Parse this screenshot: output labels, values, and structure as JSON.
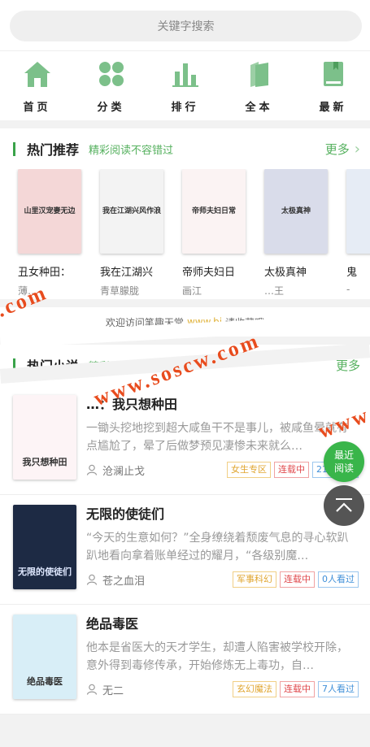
{
  "search": {
    "placeholder": "关键字搜索"
  },
  "nav": [
    {
      "label": "首页",
      "icon": "home-icon"
    },
    {
      "label": "分类",
      "icon": "category-icon"
    },
    {
      "label": "排行",
      "icon": "ranking-icon"
    },
    {
      "label": "全本",
      "icon": "complete-books-icon"
    },
    {
      "label": "最新",
      "icon": "latest-book-icon"
    }
  ],
  "hot_recommend": {
    "title": "热门推荐",
    "subtitle": "精彩阅读不容错过",
    "more": "更多",
    "books": [
      {
        "title": "丑女种田：",
        "author": "薄…",
        "cover_text": "山里汉宠妻无边",
        "cover_color": "#f4d7d7"
      },
      {
        "title": "我在江湖兴",
        "author": "青草朦胧",
        "cover_text": "我在江湖兴风作浪",
        "cover_color": "#f3f3f3"
      },
      {
        "title": "帝师夫妇日",
        "author": "画江",
        "cover_text": "帝师夫妇日常",
        "cover_color": "#fbf3f3"
      },
      {
        "title": "太极真神",
        "author": "…王",
        "cover_text": "太极真神",
        "cover_color": "#d9dcea"
      },
      {
        "title": "鬼",
        "author": "-",
        "cover_text": "",
        "cover_color": "#e6ecf5"
      }
    ]
  },
  "welcome": {
    "prefix": "欢迎访问笔趣天堂",
    "url": "www.bi",
    "suffix": "请收藏哦"
  },
  "hot_novels": {
    "title": "热门小说",
    "subtitle": "精彩…",
    "more": "更多",
    "items": [
      {
        "title": "…：我只想种田",
        "desc": "一锄头挖地挖到超大咸鱼干不是事儿，被咸鱼晕就有点尴尬了，晕了后做梦预见凄惨未来就么…",
        "author": "沧澜止戈",
        "category": "女生专区",
        "status": "连载中",
        "views": "21人看过",
        "cover_text": "我只想种田",
        "cover_color": "#fdf4f6"
      },
      {
        "title": "无限的使徒们",
        "desc": "“今天的生意如何？”全身缭绕着颓废气息的寻心软趴趴地看向拿着账单经过的耀月，“各级别魔…",
        "author": "苍之血泪",
        "category": "军事科幻",
        "status": "连载中",
        "views": "0人看过",
        "cover_text": "无限的使徒们",
        "cover_color": "#1d2a44"
      },
      {
        "title": "绝品毒医",
        "desc": "他本是省医大的天才学生，却遭人陷害被学校开除，意外得到毒修传承，开始修炼无上毒功，自…",
        "author": "无二",
        "category": "玄幻魔法",
        "status": "连载中",
        "views": "7人看过",
        "cover_text": "绝品毒医",
        "cover_color": "#d8eef7"
      }
    ]
  },
  "float": {
    "recent_label": "最近阅读"
  },
  "watermark": "www.soscw.com",
  "colors": {
    "accent": "#3aa34a",
    "watermark": "#e84c1e",
    "tag_category": "#e0a52f",
    "tag_status": "#e0484c",
    "tag_views": "#3f8fd8"
  }
}
